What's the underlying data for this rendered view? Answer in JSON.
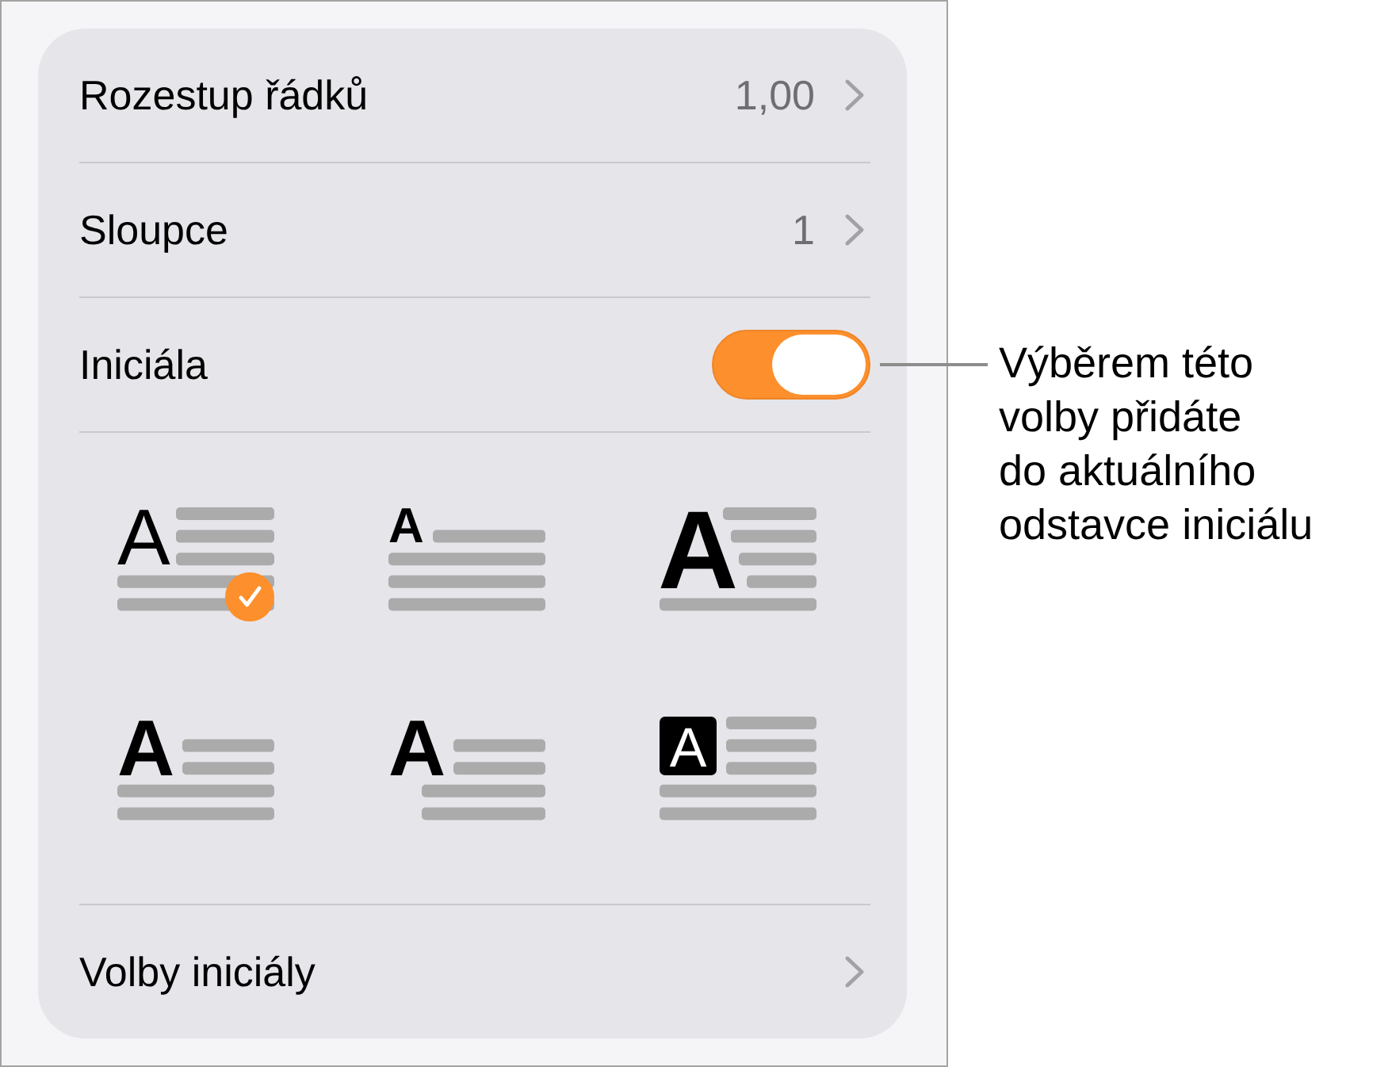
{
  "rows": [
    {
      "kind": "value",
      "label": "Rozestup řádků",
      "value": "1,00"
    },
    {
      "kind": "value",
      "label": "Sloupce",
      "value": "1"
    },
    {
      "kind": "toggle",
      "label": "Iniciála",
      "on": true
    }
  ],
  "drop_cap_styles": [
    {
      "kind": "light",
      "letter": "A",
      "selected": true
    },
    {
      "kind": "raised",
      "letter": "A",
      "selected": false
    },
    {
      "kind": "large",
      "letter": "A",
      "selected": false
    },
    {
      "kind": "bold",
      "letter": "A",
      "selected": false
    },
    {
      "kind": "hanging",
      "letter": "A",
      "selected": false
    },
    {
      "kind": "boxed",
      "letter": "A",
      "selected": false
    }
  ],
  "options_row": {
    "label": "Volby iniciály"
  },
  "callout": {
    "text": "Výběrem této\nvolby přidáte\ndo aktuálního\nodstavce iniciálu"
  }
}
